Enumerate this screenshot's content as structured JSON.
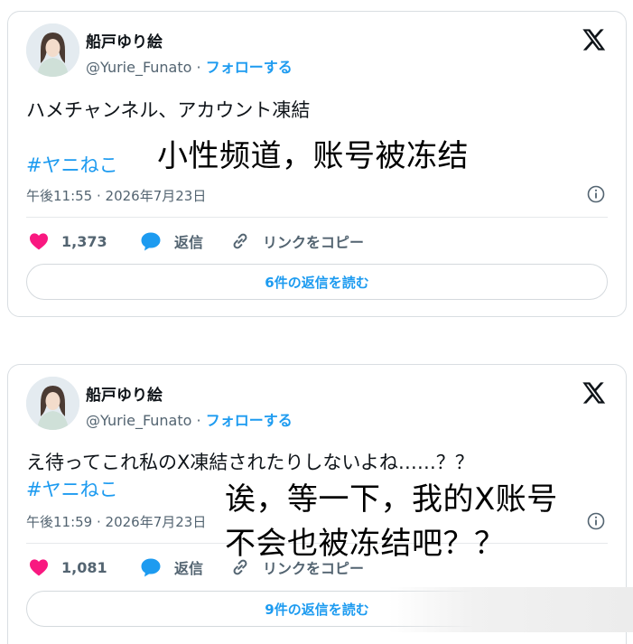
{
  "tweets": [
    {
      "author_name": "船戸ゆり絵",
      "handle": "@Yurie_Funato",
      "separator": " · ",
      "follow_label": "フォローする",
      "text": "ハメチャンネル、アカウント凍結",
      "hashtag": "#ヤニねこ",
      "caption_lines": [
        "小性频道，账号被冻结"
      ],
      "timestamp": "午後11:55 · 2026年7月23日",
      "likes": "1,373",
      "reply_label": "返信",
      "copy_link_label": "リンクをコピー",
      "read_replies_label": "6件の返信を読む"
    },
    {
      "author_name": "船戸ゆり絵",
      "handle": "@Yurie_Funato",
      "separator": " · ",
      "follow_label": "フォローする",
      "text": "え待ってこれ私のX凍結されたりしないよね……？？",
      "hashtag": "#ヤニねこ",
      "caption_lines": [
        "诶，等一下，我的X账号",
        "不会也被冻结吧？？"
      ],
      "timestamp": "午後11:59 · 2026年7月23日",
      "likes": "1,081",
      "reply_label": "返信",
      "copy_link_label": "リンクをコピー",
      "read_replies_label": "9件の返信を読む"
    }
  ],
  "colors": {
    "accent": "#1d9bf0",
    "heart": "#f91880",
    "muted": "#536471"
  },
  "icons": [
    "x-logo-icon",
    "heart-icon",
    "reply-bubble-icon",
    "link-icon",
    "info-icon"
  ]
}
